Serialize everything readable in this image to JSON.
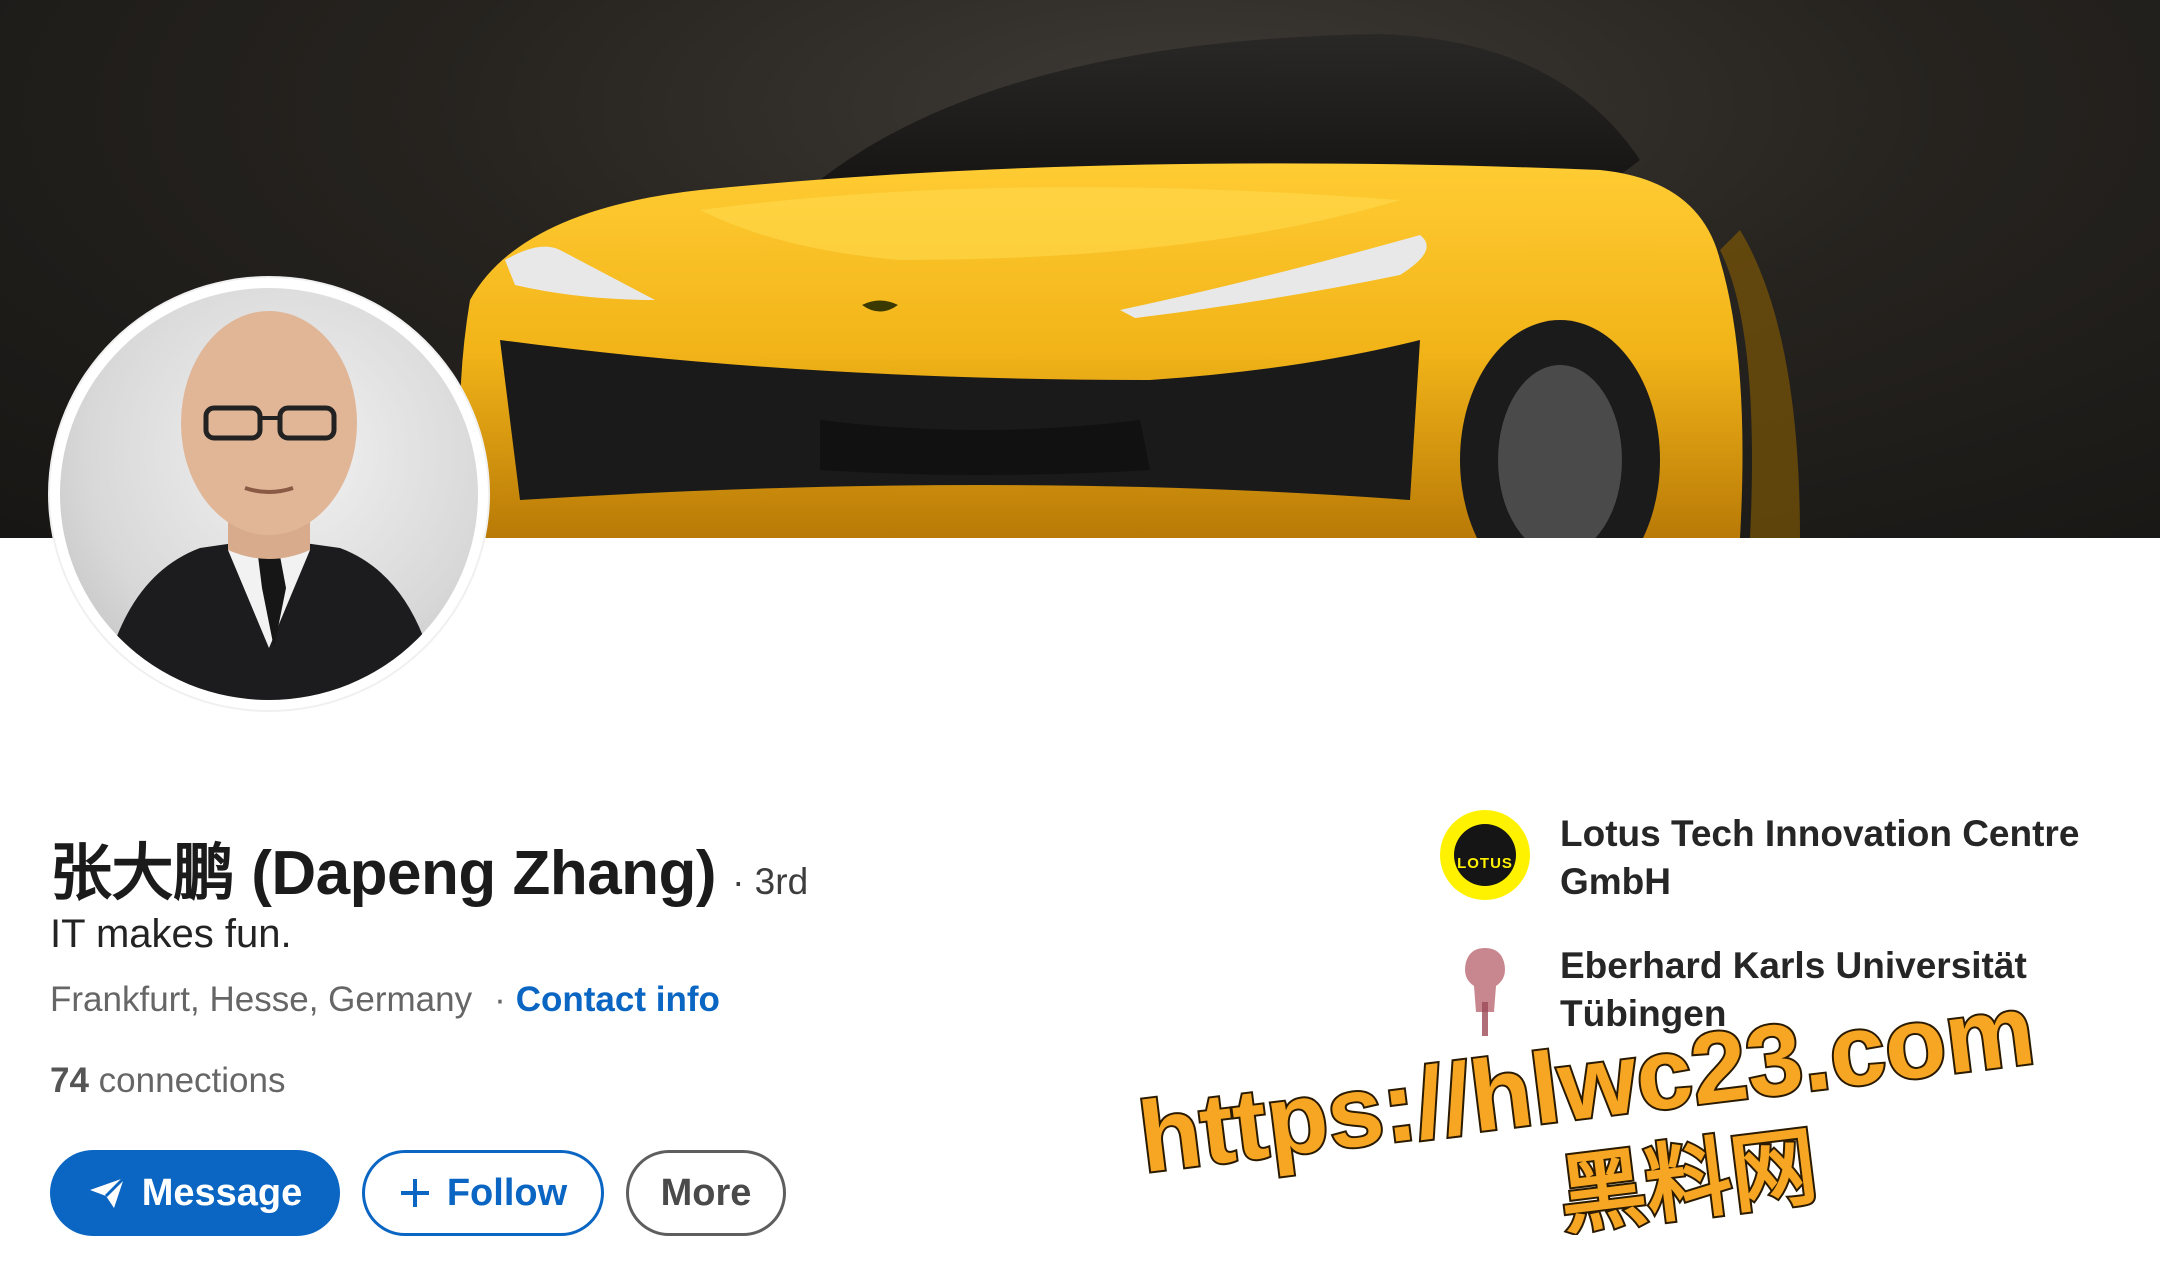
{
  "profile": {
    "name": "张大鹏 (Dapeng Zhang)",
    "degree": "· 3rd",
    "headline": "IT makes fun.",
    "location": "Frankfurt, Hesse, Germany",
    "separator": "·",
    "contact_info": "Contact info",
    "connections_count": "74",
    "connections_label": "connections"
  },
  "actions": {
    "message": "Message",
    "follow": "Follow",
    "more": "More"
  },
  "organizations": [
    {
      "name": "Lotus Tech Innovation Centre GmbH",
      "logo_text": "LOTUS",
      "icon": "lotus-logo-icon"
    },
    {
      "name": "Eberhard Karls Universität Tübingen",
      "icon": "university-seal-icon"
    }
  ],
  "watermark": {
    "line1": "https://hlwc23.com",
    "line2": "黑料网"
  },
  "colors": {
    "linkedin_blue": "#0a66c2",
    "lotus_yellow": "#fff200",
    "car_yellow": "#f2b418",
    "watermark_orange": "#f6a623"
  }
}
